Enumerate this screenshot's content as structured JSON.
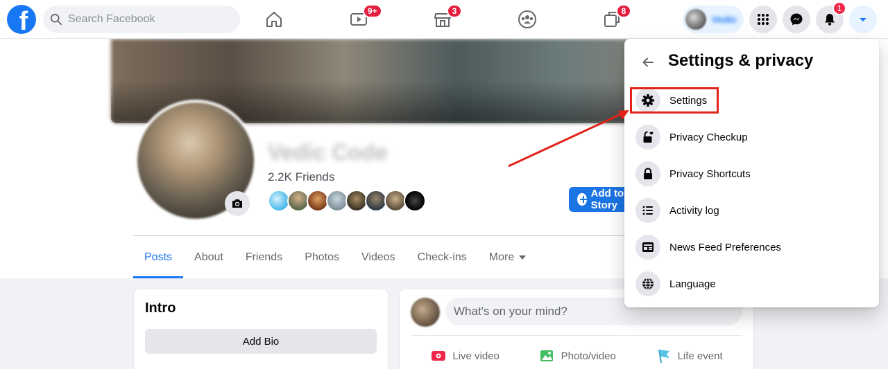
{
  "topbar": {
    "search_placeholder": "Search Facebook",
    "nav": [
      {
        "icon": "home-icon",
        "badge": ""
      },
      {
        "icon": "watch-icon",
        "badge": "9+"
      },
      {
        "icon": "marketplace-icon",
        "badge": "3"
      },
      {
        "icon": "groups-icon",
        "badge": ""
      },
      {
        "icon": "gaming-icon",
        "badge": "8"
      }
    ],
    "notifications_badge": "1",
    "profile_name": "Vedic"
  },
  "profile": {
    "name": "Vedic Code",
    "friends_count": "2.2K Friends",
    "add_button": "Add to Story"
  },
  "tabs": [
    "Posts",
    "About",
    "Friends",
    "Photos",
    "Videos",
    "Check-ins",
    "More"
  ],
  "intro": {
    "title": "Intro",
    "add_bio": "Add Bio"
  },
  "composer": {
    "placeholder": "What's on your mind?",
    "actions": [
      "Live video",
      "Photo/video",
      "Life event"
    ]
  },
  "menu": {
    "title": "Settings & privacy",
    "items": [
      {
        "label": "Settings",
        "icon": "gear-icon"
      },
      {
        "label": "Privacy Checkup",
        "icon": "lock-heart-icon"
      },
      {
        "label": "Privacy Shortcuts",
        "icon": "lock-icon"
      },
      {
        "label": "Activity log",
        "icon": "list-icon"
      },
      {
        "label": "News Feed Preferences",
        "icon": "feed-icon"
      },
      {
        "label": "Language",
        "icon": "globe-icon"
      }
    ]
  },
  "colors": {
    "brand": "#1877f2",
    "badge": "#e41e3f",
    "annotation": "#e2231a"
  }
}
